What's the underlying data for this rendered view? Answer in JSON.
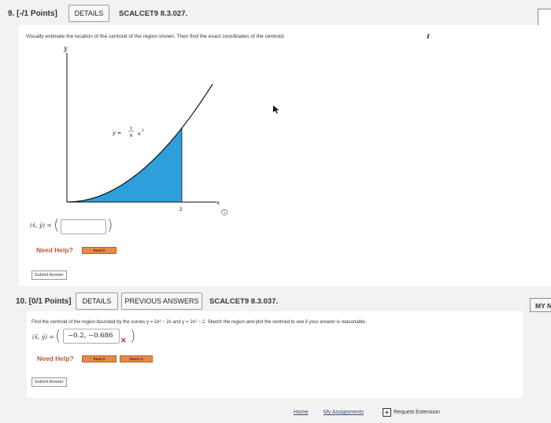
{
  "q9": {
    "header": "9.  [-/1 Points]",
    "details_label": "DETAILS",
    "code": "SCALCET9 8.3.027.",
    "prompt": "Visually estimate the location of the centroid of the region shown. Then find the exact coordinates of the centroid.",
    "graph": {
      "y_axis_label": "y",
      "x_axis_label": "x",
      "x_tick": "2",
      "curve_eq_lhs": "y =",
      "curve_eq_num": "1",
      "curve_eq_den": "6",
      "curve_eq_var": "x",
      "curve_eq_exp": "2",
      "info_icon": "info-circle-icon"
    },
    "answer_label": "(x̄, ȳ) =",
    "answer_value": "",
    "need_help": "Need Help?",
    "read_it": "Read It",
    "submit": "Submit Answer"
  },
  "q10": {
    "header": "10.  [0/1 Points]",
    "details_label": "DETAILS",
    "previous_answers_label": "PREVIOUS ANSWERS",
    "code": "SCALCET9 8.3.037.",
    "prompt": "Find the centroid of the region bounded by the curves y = 2x³ − 2x and y = 2x² − 2. Sketch the region and plot the centroid to see if your answer is reasonable.",
    "answer_label": "(x̄, ȳ) =",
    "answer_value": "−0.2, −0.686",
    "incorrect_mark": "✕",
    "need_help": "Need Help?",
    "read_it": "Read It",
    "watch_it": "Watch It",
    "submit": "Submit Answer"
  },
  "side_tab_label": "MY N",
  "footer": {
    "home": "Home",
    "assignments": "My Assignments",
    "request": "Request Extension",
    "request_icon": "plus-box-icon"
  },
  "colors": {
    "region_fill": "#2f9fdb",
    "error_red": "#d02020",
    "help_orange": "#e38a4b"
  }
}
